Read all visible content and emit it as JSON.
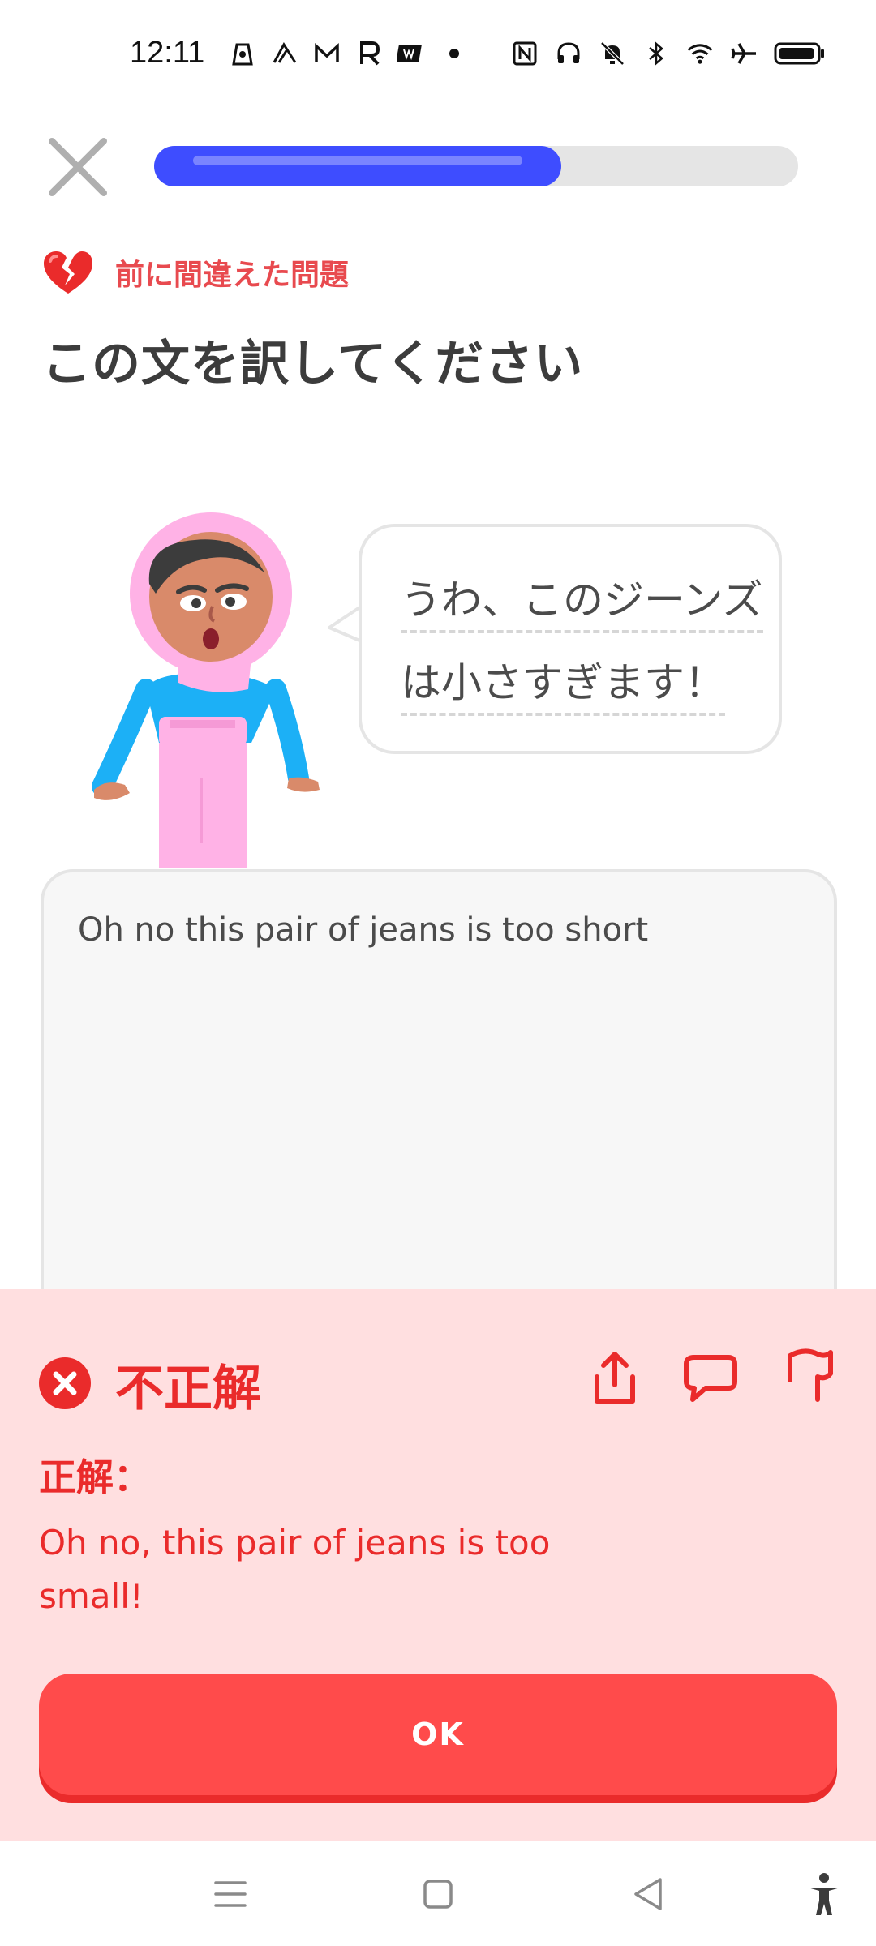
{
  "status_bar": {
    "time": "12:11",
    "left_icons": [
      "gas-app-icon",
      "swirl-app-icon",
      "gmail-icon",
      "r-app-icon",
      "ww-app-icon"
    ],
    "right_icons": [
      "nfc-icon",
      "headset-icon",
      "mute-icon",
      "bluetooth-icon",
      "wifi-icon",
      "airplane-icon",
      "battery-icon"
    ]
  },
  "lesson": {
    "progress": 0.6,
    "mistake_label": "前に間違えた問題",
    "instruction": "この文を訳してください",
    "prompt_line1": "うわ、このジーンズ",
    "prompt_line2": "は小さすぎます！",
    "user_answer": "Oh no this pair of jeans is too short"
  },
  "result": {
    "title": "不正解",
    "correct_label": "正解：",
    "correct_answer": "Oh no, this pair of jeans is too small!",
    "ok_label": "OK"
  },
  "colors": {
    "progress": "#3e4dff",
    "error": "#ea2b2b",
    "panel": "#ffdfe0",
    "button": "#ff4b4b"
  },
  "nav_bar": {
    "icons": [
      "menu-icon",
      "home-icon",
      "back-icon",
      "accessibility-icon"
    ]
  }
}
